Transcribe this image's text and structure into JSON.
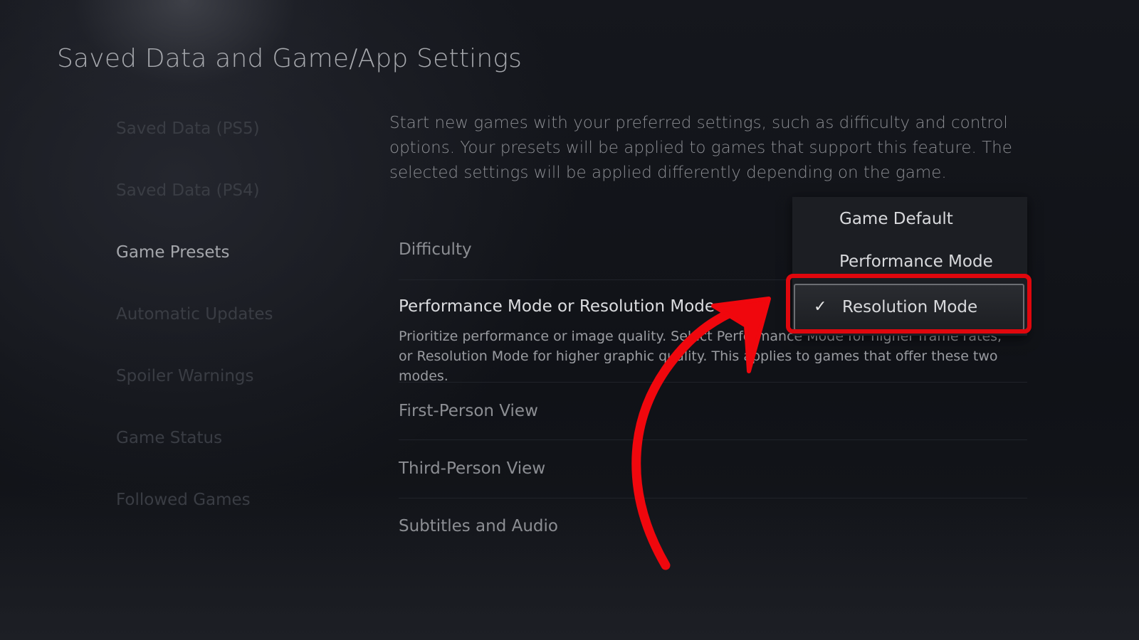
{
  "page": {
    "title": "Saved Data and Game/App Settings"
  },
  "sidebar": {
    "items": [
      {
        "label": "Saved Data (PS5)",
        "active": false
      },
      {
        "label": "Saved Data (PS4)",
        "active": false
      },
      {
        "label": "Game Presets",
        "active": true
      },
      {
        "label": "Automatic Updates",
        "active": false
      },
      {
        "label": "Spoiler Warnings",
        "active": false
      },
      {
        "label": "Game Status",
        "active": false
      },
      {
        "label": "Followed Games",
        "active": false
      }
    ]
  },
  "main": {
    "intro": "Start new games with your preferred settings, such as difficulty and control options. Your presets will be applied to games that support this feature. The selected settings will be applied differently depending on the game.",
    "settings": [
      {
        "label": "Difficulty"
      },
      {
        "label": "Performance Mode or Resolution Mode",
        "description": "Prioritize performance or image quality. Select Performance Mode for higher frame rates, or Resolution Mode for higher graphic quality. This applies to games that offer these two modes."
      },
      {
        "label": "First-Person View"
      },
      {
        "label": "Third-Person View"
      },
      {
        "label": "Subtitles and Audio"
      }
    ]
  },
  "dropdown": {
    "options": [
      {
        "label": "Game Default",
        "selected": false
      },
      {
        "label": "Performance Mode",
        "selected": false
      },
      {
        "label": "Resolution Mode",
        "selected": true
      }
    ],
    "check_icon": "✓"
  },
  "annotation": {
    "highlight_color": "#e0070d",
    "arrow_color": "#f0070d"
  }
}
